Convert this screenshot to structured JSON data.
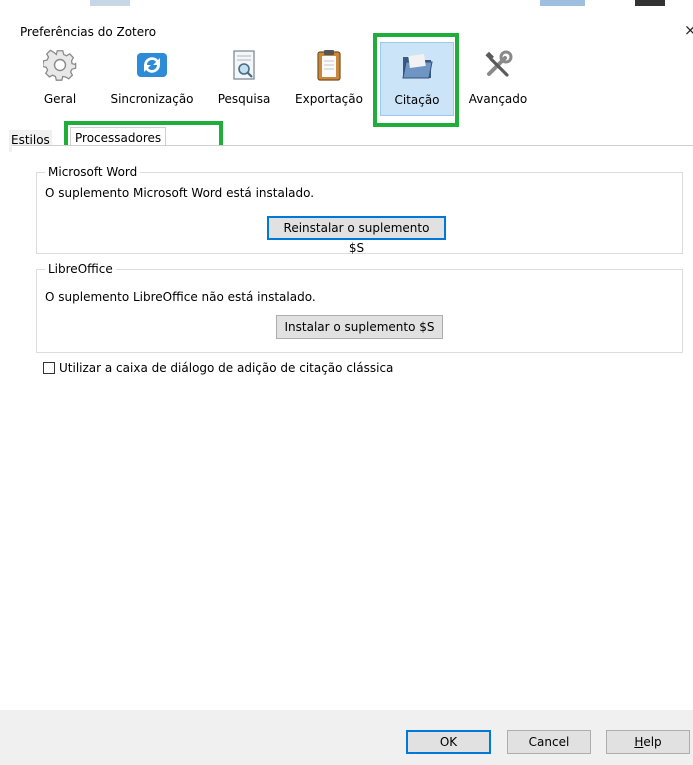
{
  "window": {
    "title": "Preferências do Zotero",
    "close_glyph": "×"
  },
  "toolbar": {
    "items": [
      {
        "label": "Geral",
        "icon": "gear-icon"
      },
      {
        "label": "Sincronização",
        "icon": "sync-icon"
      },
      {
        "label": "Pesquisa",
        "icon": "search-document-icon"
      },
      {
        "label": "Exportação",
        "icon": "clipboard-icon"
      },
      {
        "label": "Citação",
        "icon": "folder-icon",
        "selected": true
      },
      {
        "label": "Avançado",
        "icon": "tools-icon"
      }
    ]
  },
  "tabs": [
    {
      "label": "Estilos"
    },
    {
      "label": "Processadores de texto",
      "selected": true
    }
  ],
  "word": {
    "legend": "Microsoft Word",
    "status": "O suplemento Microsoft Word está instalado.",
    "button": "Reinstalar o suplemento $S"
  },
  "libreoffice": {
    "legend": "LibreOffice",
    "status": "O suplemento LibreOffice não está instalado.",
    "button": "Instalar o suplemento $S"
  },
  "classic_dialog": {
    "label": "Utilizar a caixa de diálogo de adição de citação clássica",
    "checked": false
  },
  "footer": {
    "ok": "OK",
    "cancel": "Cancel",
    "help": "Help"
  },
  "colors": {
    "highlight": "#1fae3a",
    "selected_bg": "#cce4f7",
    "focus": "#0078d7"
  }
}
